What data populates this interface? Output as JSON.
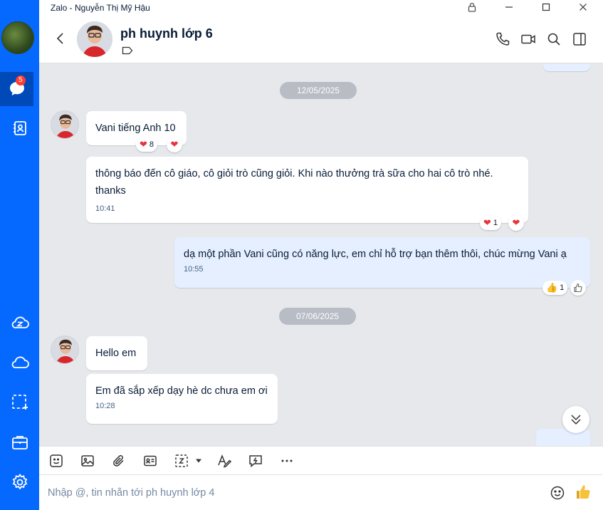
{
  "window": {
    "title": "Zalo - Nguyễn Thị Mỹ Hậu",
    "controls": [
      "lock-icon",
      "minimize-icon",
      "maximize-icon",
      "close-icon"
    ]
  },
  "nav": {
    "badge": "5",
    "items": [
      "messages-icon",
      "contacts-icon",
      "zcloud-icon",
      "cloud-icon",
      "screenshot-icon",
      "briefcase-icon",
      "settings-icon"
    ]
  },
  "header": {
    "chat_name": "ph huynh lớp 6",
    "icons": [
      "call-icon",
      "video-call-icon",
      "search-icon",
      "sidebar-toggle-icon"
    ]
  },
  "messages": {
    "date1": "12/05/2025",
    "m1_text": "Vani tiếng Anh 10",
    "m1_react_count": "8",
    "m2_text": "thông báo đến cô giáo, cô giỏi trò cũng giỏi. Khi nào thưởng trà sữa cho hai cô trò nhé. thanks",
    "m2_time": "10:41",
    "m2_react_count": "1",
    "m3_text": "dạ một phần Vani cũng có năng lực, em chỉ hỗ trợ bạn thêm thôi, chúc mừng Vani ạ",
    "m3_time": "10:55",
    "m3_react_count": "1",
    "date2": "07/06/2025",
    "m4_text": "Hello em",
    "m5_text": "Em đã sắp xếp dạy hè dc chưa em ơi",
    "m5_time": "10:28"
  },
  "toolbar": {
    "icons": [
      "sticker-icon",
      "image-icon",
      "attachment-icon",
      "contact-card-icon",
      "screenshot-icon",
      "dropdown-icon",
      "text-format-icon",
      "quick-message-icon",
      "more-icon"
    ]
  },
  "composer": {
    "placeholder": "Nhập @, tin nhắn tới ph huynh lớp 4"
  },
  "colors": {
    "nav_bg": "#0568ff",
    "chat_bg": "#e6e8ec",
    "my_bubble": "#e5efff"
  }
}
